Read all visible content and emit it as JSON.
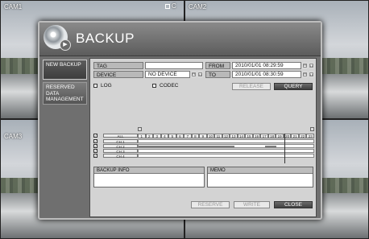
{
  "cameras": [
    {
      "label": "CAM1"
    },
    {
      "label": "CAM2"
    },
    {
      "label": "CAM3"
    },
    {
      "label": ""
    }
  ],
  "rec_indicator": "C",
  "dialog": {
    "title": "BACKUP",
    "sidebar": [
      {
        "label": "NEW BACKUP",
        "active": true
      },
      {
        "label": "RESERVED DATA MANAGEMENT",
        "active": false
      }
    ],
    "tag_label": "TAG",
    "tag_value": "",
    "device_label": "DEVICE",
    "device_value": "NO DEVICE",
    "from_label": "FROM",
    "from_value": "2010/01/01 08:29:59",
    "to_label": "TO",
    "to_value": "2010/01/01 08:30:59",
    "log_label": "LOG",
    "codec_label": "CODEC",
    "release_label": "RELEASE",
    "query_label": "QUERY",
    "all_label": "ALL",
    "hours": [
      "1",
      "2",
      "3",
      "4",
      "5",
      "6",
      "7",
      "8",
      "9",
      "10",
      "11",
      "12",
      "13",
      "14",
      "15",
      "16",
      "17",
      "18",
      "19",
      "20",
      "21",
      "22",
      "23"
    ],
    "channels": [
      {
        "name": "CH 1",
        "checked": true,
        "recording": []
      },
      {
        "name": "CH 2",
        "checked": true,
        "recording": [
          [
            0.0,
            12.5
          ],
          [
            16.5,
            18.0
          ]
        ]
      },
      {
        "name": "CH 3",
        "checked": true,
        "recording": []
      },
      {
        "name": "CH 4",
        "checked": true,
        "recording": []
      }
    ],
    "backup_info_label": "BACKUP INFO",
    "memo_label": "MEMO",
    "reserve_label": "RESERVE",
    "write_label": "WRITE",
    "close_label": "CLOSE",
    "accent": "#3f3f3f"
  }
}
